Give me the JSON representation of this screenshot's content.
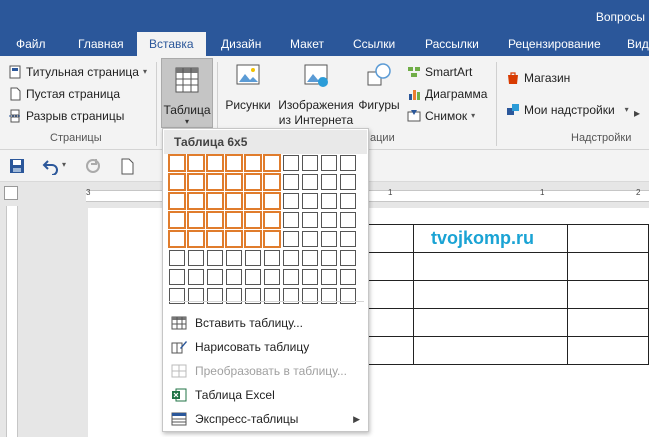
{
  "window": {
    "title": "Вопросы"
  },
  "tabs": [
    {
      "label": "Файл"
    },
    {
      "label": "Главная"
    },
    {
      "label": "Вставка"
    },
    {
      "label": "Дизайн"
    },
    {
      "label": "Макет"
    },
    {
      "label": "Ссылки"
    },
    {
      "label": "Рассылки"
    },
    {
      "label": "Рецензирование"
    },
    {
      "label": "Вид"
    }
  ],
  "ribbon": {
    "pages": {
      "cover": "Титульная страница",
      "blank": "Пустая страница",
      "break": "Разрыв страницы",
      "group": "Страницы"
    },
    "table_button": "Таблица",
    "illustrations": {
      "pictures": "Рисунки",
      "online_line1": "Изображения",
      "online_line2": "из Интернета",
      "shapes": "Фигуры",
      "smartart": "SmartArt",
      "chart": "Диаграмма",
      "screenshot": "Снимок",
      "group_tail": "ации"
    },
    "addins": {
      "store": "Магазин",
      "my_addins": "Мои надстройки",
      "group": "Надстройки"
    }
  },
  "ruler": {
    "numbers": [
      "3",
      "1",
      "1",
      "2"
    ]
  },
  "document": {
    "watermark": "tvojkomp.ru"
  },
  "table_menu": {
    "header": "Таблица 6x5",
    "grid": {
      "cols": 10,
      "rows": 8,
      "selected_cols": 6,
      "selected_rows": 5
    },
    "items": [
      {
        "label": "Вставить таблицу...",
        "enabled": true
      },
      {
        "label": "Нарисовать таблицу",
        "enabled": true
      },
      {
        "label": "Преобразовать в таблицу...",
        "enabled": false
      },
      {
        "label": "Таблица Excel",
        "enabled": true
      },
      {
        "label": "Экспресс-таблицы",
        "enabled": true,
        "submenu": true
      }
    ]
  },
  "colors": {
    "brand": "#2b579a",
    "selection": "#e07c2c",
    "watermark": "#1aa3d4"
  }
}
